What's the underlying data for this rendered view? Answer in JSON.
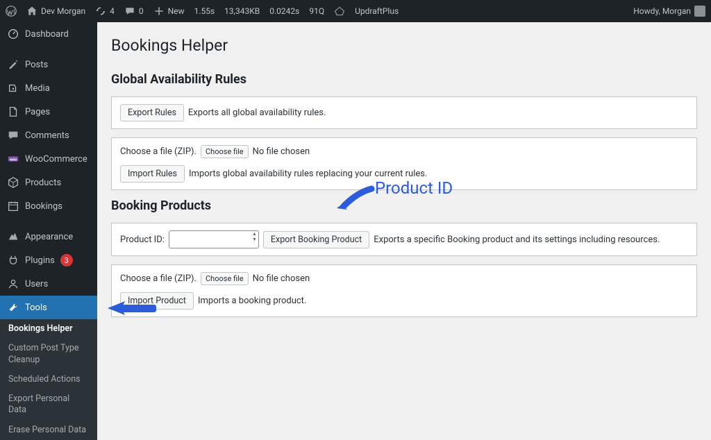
{
  "adminbar": {
    "site_name": "Dev Morgan",
    "updates": "4",
    "comments": "0",
    "new": "New",
    "perf_time": "1.55s",
    "perf_size": "13,343KB",
    "perf_overhead": "0.0242s",
    "perf_queries": "91Q",
    "updraft": "UpdraftPlus",
    "howdy": "Howdy, Morgan"
  },
  "sidebar": {
    "items": [
      {
        "label": "Dashboard"
      },
      {
        "label": "Posts"
      },
      {
        "label": "Media"
      },
      {
        "label": "Pages"
      },
      {
        "label": "Comments"
      },
      {
        "label": "WooCommerce"
      },
      {
        "label": "Products"
      },
      {
        "label": "Bookings"
      },
      {
        "label": "Appearance"
      },
      {
        "label": "Plugins",
        "badge": "3"
      },
      {
        "label": "Users"
      },
      {
        "label": "Tools"
      }
    ],
    "sub": [
      {
        "label": "Bookings Helper"
      },
      {
        "label": "Custom Post Type Cleanup"
      },
      {
        "label": "Scheduled Actions"
      },
      {
        "label": "Export Personal Data"
      },
      {
        "label": "Erase Personal Data"
      }
    ]
  },
  "page": {
    "title": "Bookings Helper",
    "section1": "Global Availability Rules",
    "export_rules_btn": "Export Rules",
    "export_rules_desc": "Exports all global availability rules.",
    "choose_file_label": "Choose a file (ZIP).",
    "choose_file_btn": "Choose file",
    "no_file": "No file chosen",
    "import_rules_btn": "Import Rules",
    "import_rules_desc": "Imports global availability rules replacing your current rules.",
    "section2": "Booking Products",
    "product_id_label": "Product ID:",
    "export_product_btn": "Export Booking Product",
    "export_product_desc": "Exports a specific Booking product and its settings including resources.",
    "import_product_btn": "Import Product",
    "import_product_desc": "Imports a booking product.",
    "annotation": "Product ID"
  }
}
